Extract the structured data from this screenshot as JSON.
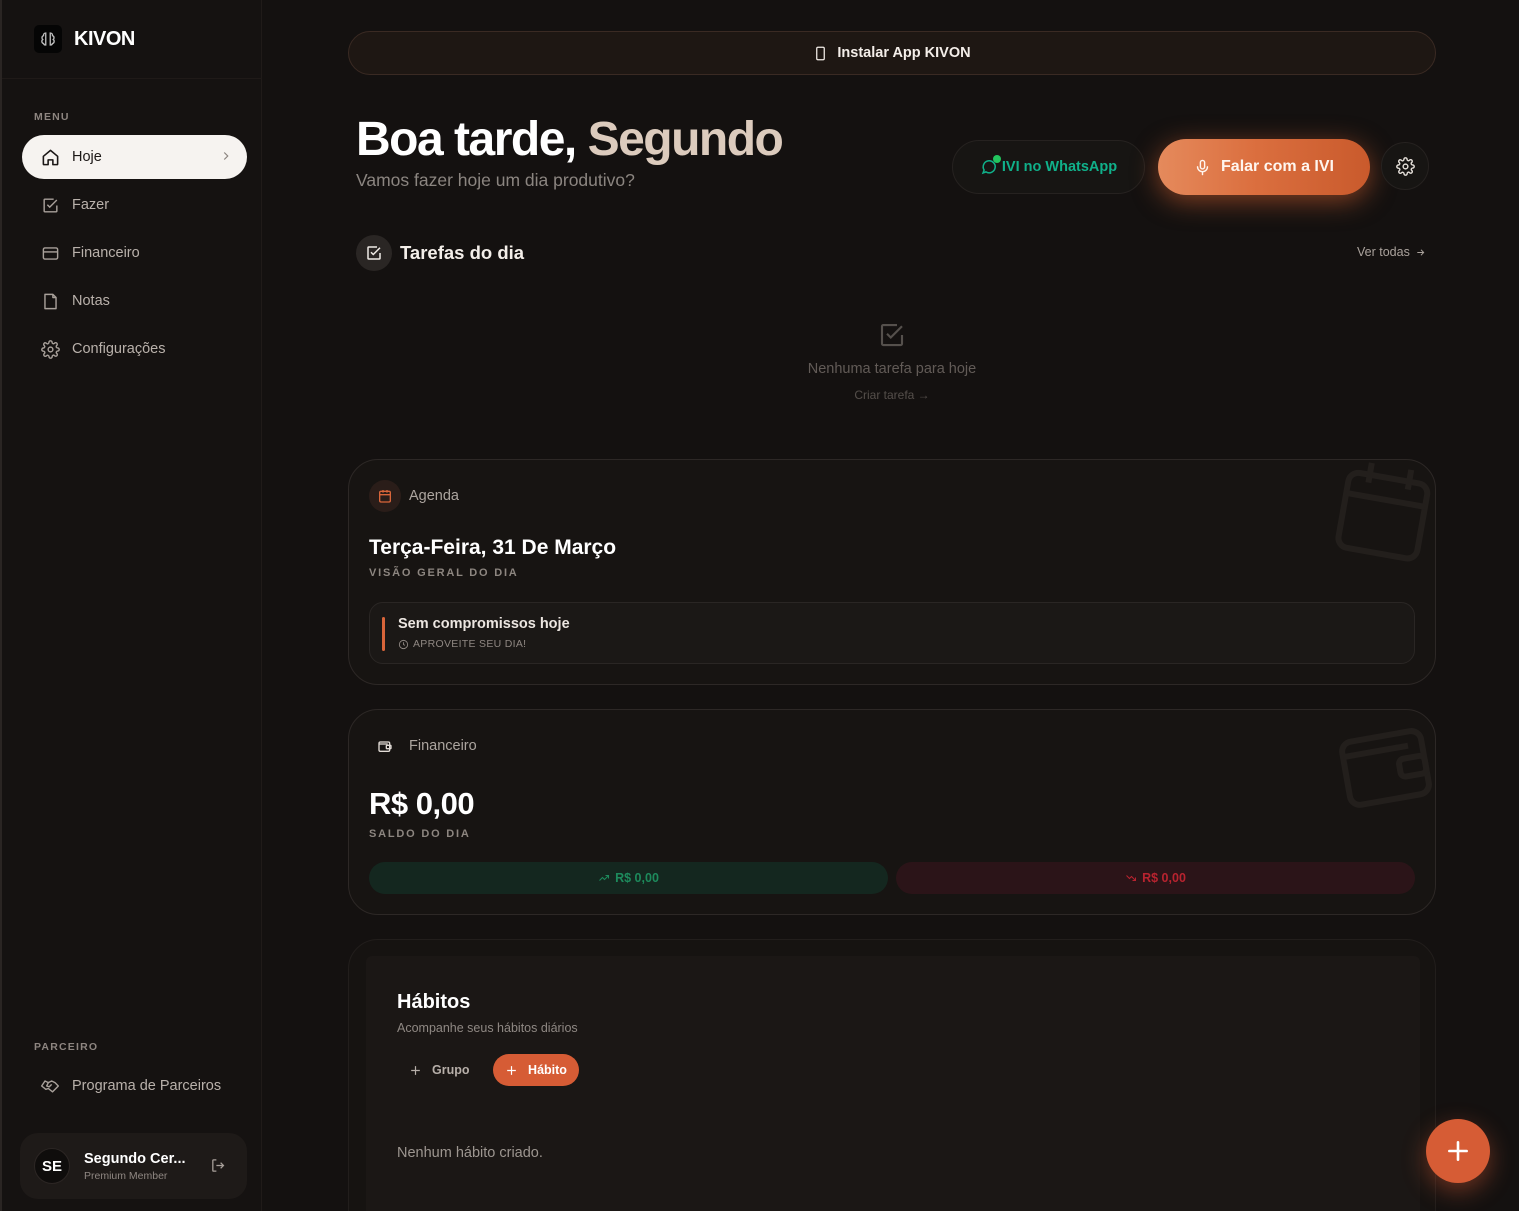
{
  "brand": {
    "name": "KIVON",
    "logo_icon": "brain-icon"
  },
  "sidebar": {
    "menu_label": "MENU",
    "items": [
      {
        "label": "Hoje",
        "icon": "home-icon",
        "active": true
      },
      {
        "label": "Fazer",
        "icon": "checkbox-icon"
      },
      {
        "label": "Financeiro",
        "icon": "credit-card-icon"
      },
      {
        "label": "Notas",
        "icon": "note-icon"
      },
      {
        "label": "Configurações",
        "icon": "gear-icon"
      }
    ],
    "partner_label": "PARCEIRO",
    "partner_item": {
      "label": "Programa de Parceiros",
      "icon": "handshake-icon"
    },
    "user": {
      "initials": "SE",
      "name": "Segundo Cer...",
      "role": "Premium Member"
    }
  },
  "install_bar": {
    "label": "Instalar App KIVON"
  },
  "header": {
    "greeting_prefix": "Boa tarde, ",
    "greeting_name": "Segundo",
    "subtitle": "Vamos fazer hoje um dia produtivo?",
    "whatsapp_label": "IVI no WhatsApp",
    "talk_label": "Falar com a IVI"
  },
  "tasks": {
    "title": "Tarefas do dia",
    "see_all": "Ver todas",
    "empty_text": "Nenhuma tarefa para hoje",
    "create_link": "Criar tarefa →"
  },
  "agenda": {
    "label": "Agenda",
    "date": "Terça-Feira, 31 De Março",
    "caption": "VISÃO GERAL DO DIA",
    "empty_title": "Sem compromissos hoje",
    "empty_sub": "APROVEITE SEU DIA!"
  },
  "finance": {
    "label": "Financeiro",
    "balance": "R$ 0,00",
    "caption": "SALDO DO DIA",
    "income": "R$ 0,00",
    "expense": "R$ 0,00"
  },
  "habits": {
    "title": "Hábitos",
    "subtitle": "Acompanhe seus hábitos diários",
    "group_button": "Grupo",
    "habit_button": "Hábito",
    "empty_text": "Nenhum hábito criado."
  },
  "colors": {
    "accent": "#d65c35",
    "whatsapp": "#10b08a",
    "income": "#1d8a5c",
    "expense": "#b8232f"
  }
}
